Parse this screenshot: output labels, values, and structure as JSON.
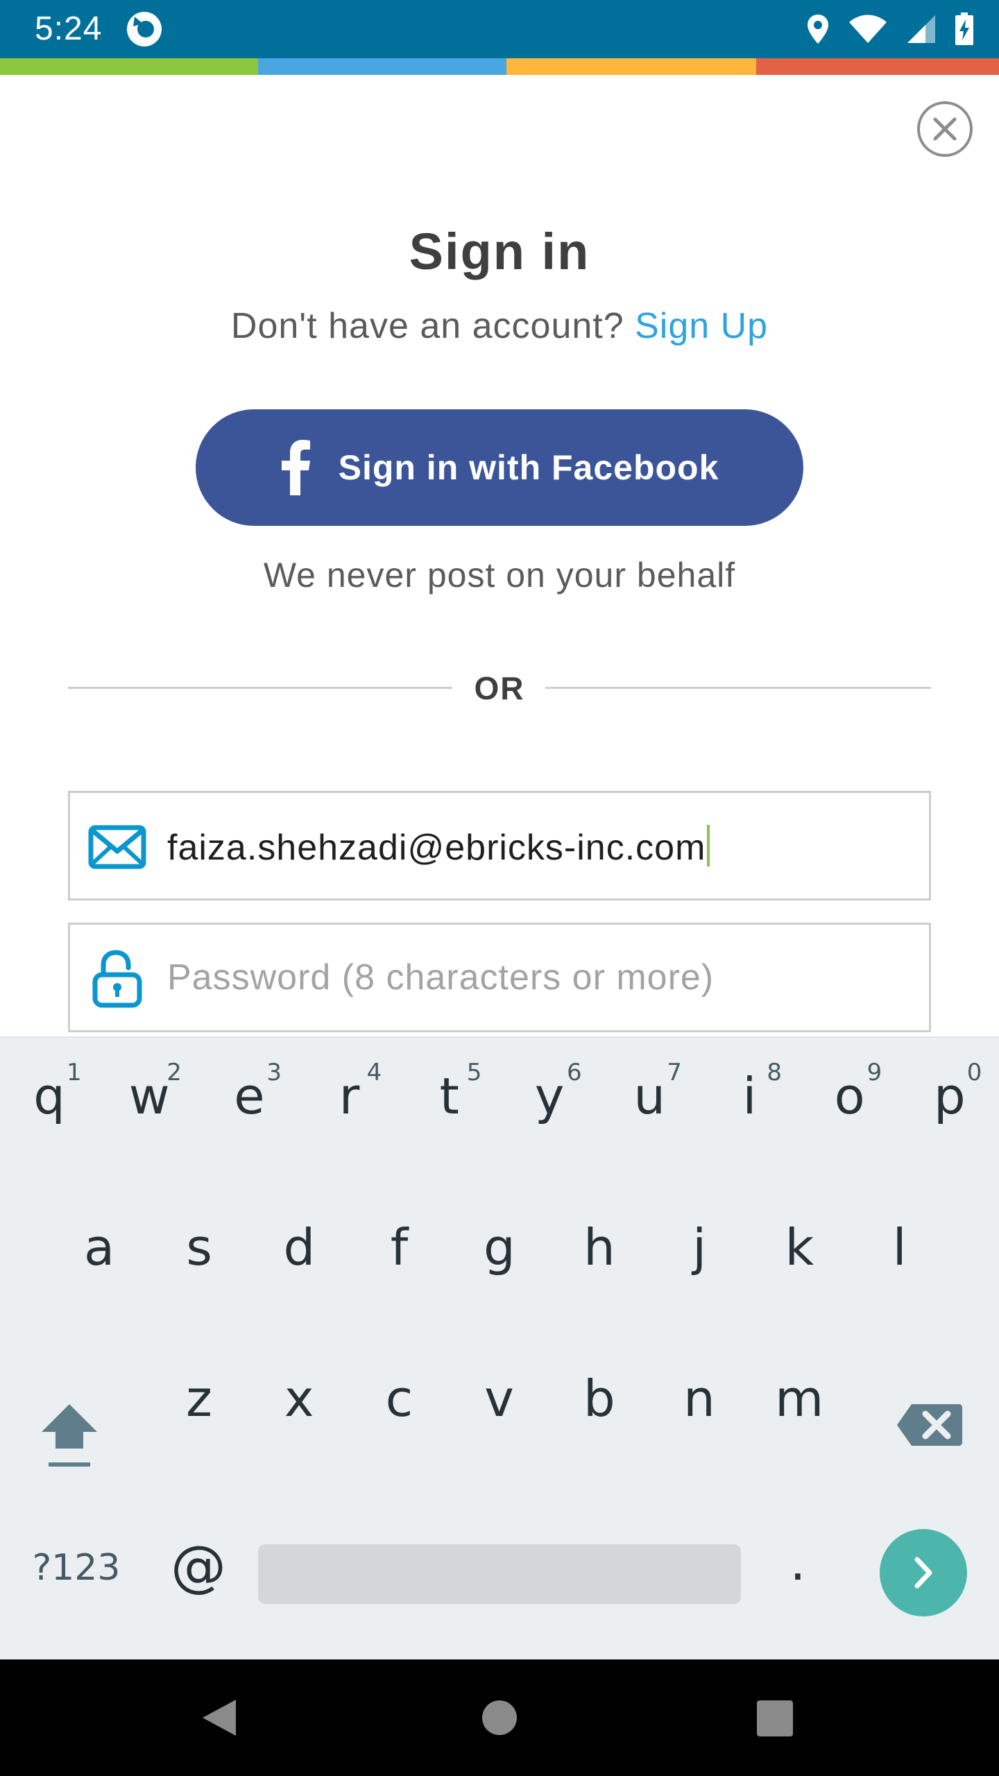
{
  "status_bar": {
    "time": "5:24",
    "icons": [
      "app-sync-icon",
      "location-icon",
      "wifi-icon",
      "signal-icon",
      "battery-charging-icon"
    ]
  },
  "stripe_colors": [
    "#8cc63e",
    "#4aa6e0",
    "#fdb53a",
    "#e36244"
  ],
  "close": {
    "icon": "close-icon"
  },
  "auth": {
    "title": "Sign in",
    "prompt": "Don't have an account?",
    "signup_link": "Sign Up",
    "facebook_button": "Sign in with Facebook",
    "facebook_note": "We never post on your behalf",
    "divider": "OR"
  },
  "form": {
    "email_value": "faiza.shehzadi@ebricks-inc.com",
    "password_placeholder": "Password (8 characters or more)"
  },
  "keyboard": {
    "row1": [
      "q",
      "w",
      "e",
      "r",
      "t",
      "y",
      "u",
      "i",
      "o",
      "p"
    ],
    "row1_hints": [
      "1",
      "2",
      "3",
      "4",
      "5",
      "6",
      "7",
      "8",
      "9",
      "0"
    ],
    "row2": [
      "a",
      "s",
      "d",
      "f",
      "g",
      "h",
      "j",
      "k",
      "l"
    ],
    "row3": [
      "z",
      "x",
      "c",
      "v",
      "b",
      "n",
      "m"
    ],
    "symbols_key": "?123",
    "at_key": "@",
    "period_key": "."
  },
  "colors": {
    "status_bar": "#00709b",
    "facebook": "#3b5598",
    "link": "#2ea3dd",
    "accent_icon": "#0a96cf",
    "enter_key": "#4db6ac"
  }
}
